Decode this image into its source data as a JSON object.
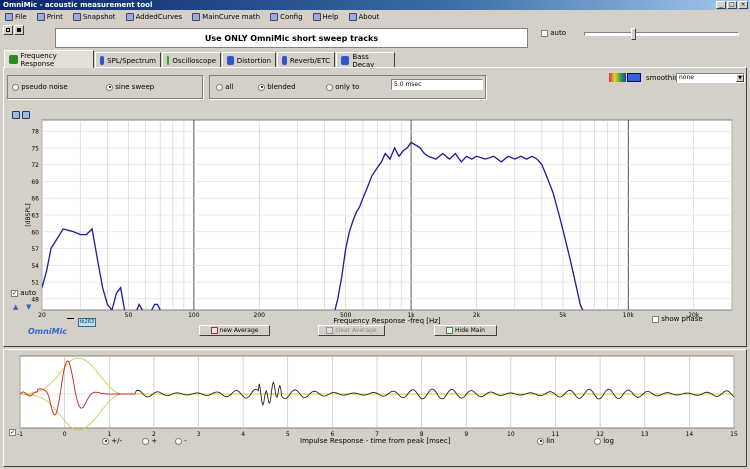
{
  "window": {
    "title": "OmniMic - acoustic measurement tool"
  },
  "menu": [
    {
      "label": "File",
      "icon": "folder-icon"
    },
    {
      "label": "Print",
      "icon": "printer-icon"
    },
    {
      "label": "Snapshot",
      "icon": "snapshot-icon"
    },
    {
      "label": "AddedCurves",
      "icon": "curves-icon"
    },
    {
      "label": "MainCurve math",
      "icon": "calculator-icon"
    },
    {
      "label": "Config",
      "icon": "wrench-icon"
    },
    {
      "label": "Help",
      "icon": "help-icon"
    },
    {
      "label": "About",
      "icon": "info-icon"
    }
  ],
  "banner": "Use ONLY OmniMic short sweep tracks",
  "auto_label": "auto",
  "tabs": [
    {
      "label": "Frequency Response",
      "selected": true,
      "color": "#2a8a2a"
    },
    {
      "label": "SPL/Spectrum",
      "selected": false,
      "color": "#3355cc"
    },
    {
      "label": "Oscilloscope",
      "selected": false,
      "color": "#22aa22"
    },
    {
      "label": "Distortion",
      "selected": false,
      "color": "#3355cc"
    },
    {
      "label": "Reverb/ETC",
      "selected": false,
      "color": "#3355cc"
    },
    {
      "label": "Bass Decay",
      "selected": false,
      "color": "#3355cc"
    }
  ],
  "signal": {
    "pseudo_noise": "pseudo noise",
    "sine_sweep": "sine sweep"
  },
  "gate": {
    "all": "all",
    "blended": "blended",
    "only_to": "only to",
    "value": "5.0 msec"
  },
  "smoothing": {
    "label": "smoothing",
    "value": "none"
  },
  "fr": {
    "yticks": [
      78,
      75,
      72,
      69,
      66,
      63,
      60,
      57,
      54,
      51,
      48
    ],
    "ylabel": "[dBSPL]",
    "xlabel": "Frequency Response -freq [Hz]",
    "xticks": [
      {
        "v": 20,
        "t": "20"
      },
      {
        "v": 50,
        "t": "50"
      },
      {
        "v": 100,
        "t": "100"
      },
      {
        "v": 200,
        "t": "200"
      },
      {
        "v": 500,
        "t": "500"
      },
      {
        "v": 1000,
        "t": "1k"
      },
      {
        "v": 2000,
        "t": "2k"
      },
      {
        "v": 5000,
        "t": "5k"
      },
      {
        "v": 10000,
        "t": "10k"
      },
      {
        "v": 20000,
        "t": "20k"
      }
    ],
    "auto": "auto",
    "brand": "OmniMic",
    "id_badge": "tk263",
    "new_average": "new Average",
    "clear_average": "clear Average",
    "hide_main": "Hide Main",
    "show_phase": "show phase"
  },
  "ir": {
    "xlabel": "Impulse Response  - time from peak [msec]",
    "xticks": [
      -1,
      0,
      1,
      2,
      3,
      4,
      5,
      6,
      7,
      8,
      9,
      10,
      11,
      12,
      13,
      14,
      15
    ],
    "opt_pm": "+/-",
    "opt_plus": "+",
    "opt_minus": "-",
    "lin": "lin",
    "log": "log"
  },
  "chart_data": [
    {
      "type": "line",
      "xlabel": "Frequency Response -freq [Hz]",
      "ylabel": "[dBSPL]",
      "xscale": "log",
      "xlim": [
        20,
        30000
      ],
      "ylim": [
        46,
        80
      ],
      "grid": true,
      "series": [
        {
          "color": "#1a1aa0",
          "x": [
            20,
            21,
            22,
            25,
            28,
            30,
            32,
            34,
            36,
            38,
            40,
            42,
            44,
            46,
            48,
            52,
            56,
            60,
            64,
            66,
            68,
            70,
            72,
            74,
            76,
            420,
            440,
            460,
            480,
            500,
            520,
            540,
            560,
            580,
            600,
            630,
            660,
            700,
            730,
            760,
            800,
            840,
            880,
            920,
            960,
            1000,
            1050,
            1100,
            1150,
            1200,
            1300,
            1400,
            1500,
            1600,
            1700,
            1800,
            1900,
            2000,
            2200,
            2400,
            2600,
            2800,
            3000,
            3200,
            3400,
            3600,
            3800,
            4000,
            4200,
            4500,
            4800,
            5100,
            5400,
            5700,
            6000,
            6500
          ],
          "y": [
            50,
            53,
            57,
            60.5,
            60,
            59.5,
            59.5,
            60.5,
            55,
            50,
            47,
            46,
            49,
            50,
            46,
            44,
            47,
            45,
            46,
            47,
            47,
            46,
            44,
            44,
            44,
            44,
            45,
            48,
            52,
            57,
            60,
            62,
            63.5,
            64.5,
            66,
            68,
            70,
            71.5,
            72.5,
            74,
            73,
            75,
            73.5,
            74.5,
            75,
            76,
            75.5,
            75,
            74,
            73.5,
            73,
            74,
            73,
            74,
            72.5,
            73.5,
            73,
            73.5,
            73,
            73.5,
            72.5,
            73.5,
            73,
            73.5,
            73,
            73.5,
            73,
            72,
            70,
            67,
            63,
            59,
            55,
            51,
            47,
            44
          ]
        }
      ]
    },
    {
      "type": "line",
      "xlabel": "Impulse Response  - time from peak [msec]",
      "xlim": [
        -1,
        15
      ],
      "ylim": [
        -1,
        1
      ],
      "series": []
    }
  ]
}
